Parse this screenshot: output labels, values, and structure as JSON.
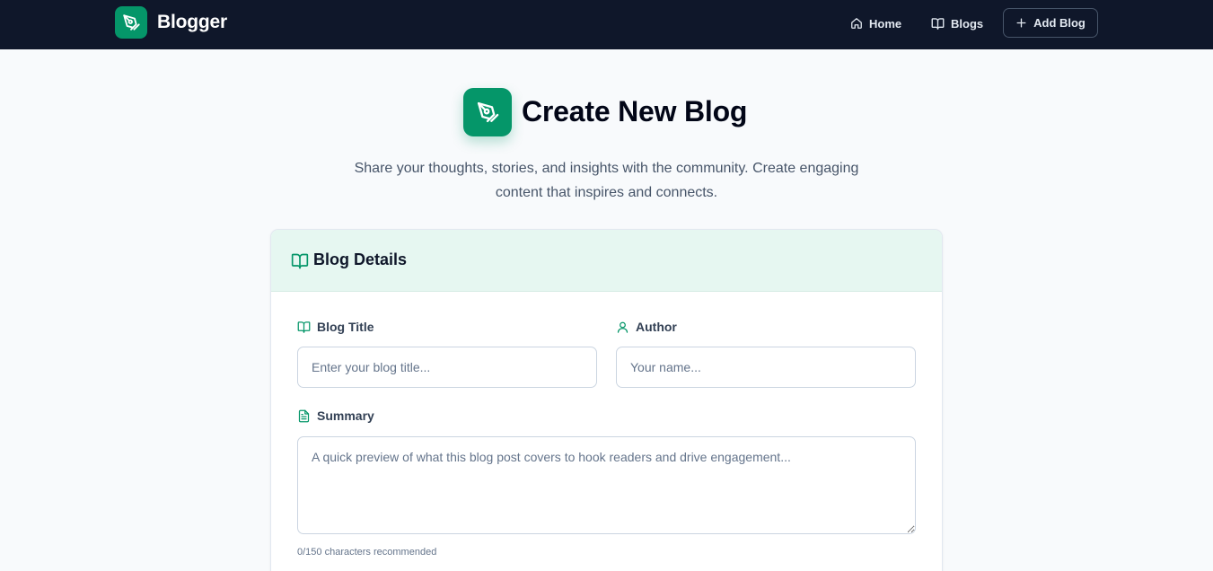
{
  "navbar": {
    "brand_name": "Blogger",
    "links": [
      {
        "label": "Home",
        "icon": "home-icon"
      },
      {
        "label": "Blogs",
        "icon": "book-open-icon"
      },
      {
        "label": "Add Blog",
        "icon": "plus-icon"
      }
    ]
  },
  "hero": {
    "title": "Create New Blog",
    "subtitle": "Share your thoughts, stories, and insights with the community. Create engaging content that inspires and connects."
  },
  "form": {
    "header_title": "Blog Details",
    "title_label": "Blog Title",
    "title_placeholder": "Enter your blog title...",
    "author_label": "Author",
    "author_placeholder": "Your name...",
    "summary_label": "Summary",
    "summary_placeholder": "A quick preview of what this blog post covers to hook readers and drive engagement...",
    "summary_count": "0/150 characters recommended"
  },
  "colors": {
    "navbar_bg": "#0f172a",
    "accent": "#059669",
    "page_bg": "#f8fafc",
    "card_header_bg": "#e6f7f1"
  }
}
